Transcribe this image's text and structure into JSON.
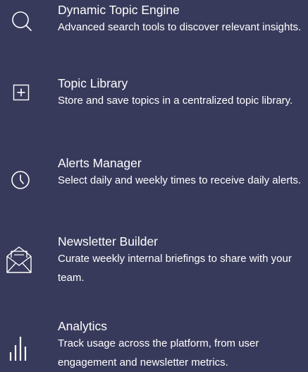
{
  "features": [
    {
      "icon": "search-icon",
      "title": "Dynamic Topic Engine",
      "description": "Advanced search tools to discover relevant insights."
    },
    {
      "icon": "plus-box-icon",
      "title": "Topic Library",
      "description": "Store and save topics in a centralized topic library."
    },
    {
      "icon": "clock-icon",
      "title": "Alerts Manager",
      "description": "Select daily and weekly times to receive daily alerts."
    },
    {
      "icon": "envelope-open-icon",
      "title": "Newsletter Builder",
      "description": "Curate weekly internal briefings to share with your team."
    },
    {
      "icon": "bar-chart-icon",
      "title": "Analytics",
      "description": "Track usage across the platform, from user engagement and newsletter metrics."
    }
  ],
  "colors": {
    "background": "#383a5b",
    "text": "#ffffff"
  }
}
